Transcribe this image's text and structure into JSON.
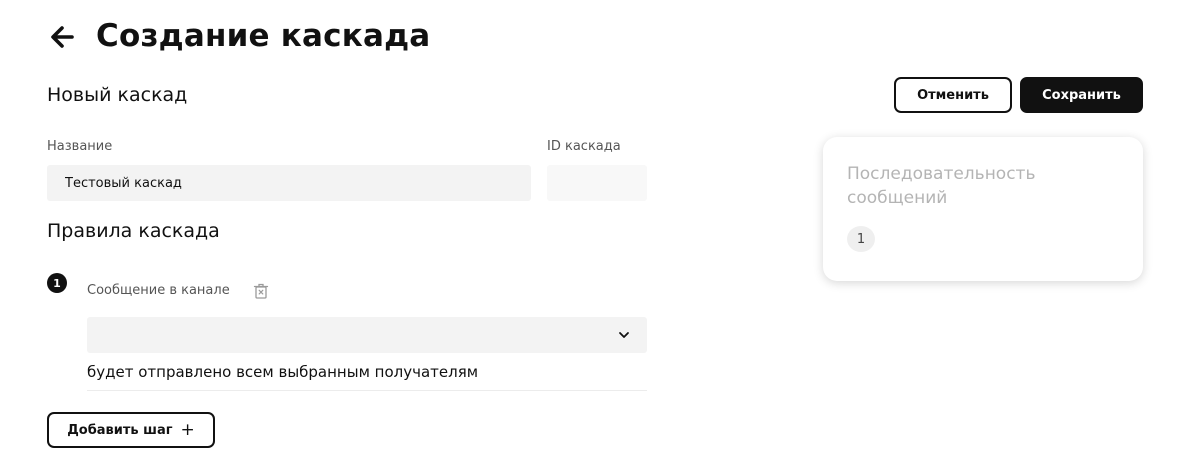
{
  "header": {
    "back_icon": "arrow-left-icon",
    "title": "Создание каскада"
  },
  "form": {
    "section_title": "Новый каскад",
    "name_label": "Название",
    "name_value": "Тестовый каскад",
    "id_label": "ID каскада",
    "id_value": ""
  },
  "rules": {
    "title": "Правила каскада",
    "steps": [
      {
        "number": "1",
        "label": "Сообщение в канале",
        "delete_icon": "trash-icon",
        "channel_value": "",
        "dropdown_icon": "chevron-down-icon",
        "description": "будет отправлено всем выбранным получателям"
      }
    ],
    "add_step_label": "Добавить шаг",
    "add_step_icon": "+"
  },
  "actions": {
    "cancel_label": "Отменить",
    "save_label": "Сохранить"
  },
  "sequence_card": {
    "title": "Последовательность сообщений",
    "steps": [
      "1"
    ]
  },
  "colors": {
    "accent": "#111111",
    "input_bg": "#f3f3f3",
    "muted_text": "#b4b4b4"
  }
}
